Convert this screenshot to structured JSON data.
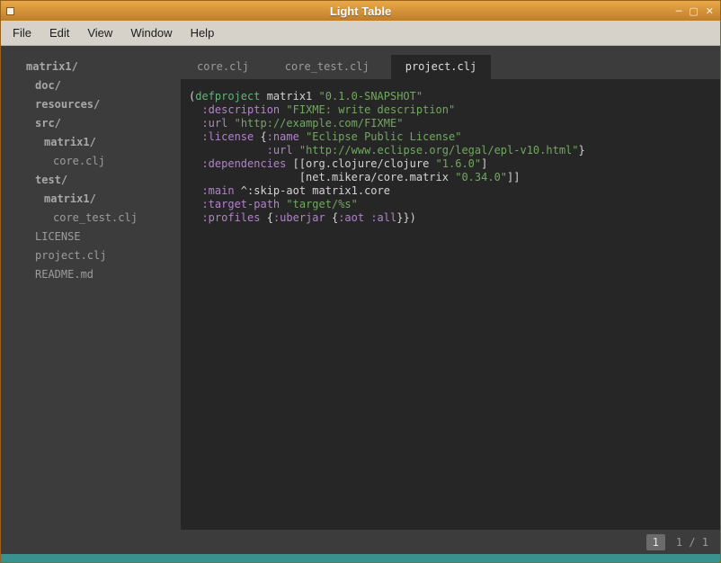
{
  "window": {
    "title": "Light Table",
    "controls": {
      "minimize": "─",
      "maximize": "▢",
      "close": "✕"
    }
  },
  "menubar": {
    "items": [
      "File",
      "Edit",
      "View",
      "Window",
      "Help"
    ]
  },
  "sidebar": {
    "items": [
      {
        "label": "matrix1/",
        "indent": 0,
        "folder": true
      },
      {
        "label": "doc/",
        "indent": 1,
        "folder": true
      },
      {
        "label": "resources/",
        "indent": 1,
        "folder": true
      },
      {
        "label": "src/",
        "indent": 1,
        "folder": true
      },
      {
        "label": "matrix1/",
        "indent": 2,
        "folder": true
      },
      {
        "label": "core.clj",
        "indent": 3,
        "folder": false
      },
      {
        "label": "test/",
        "indent": 1,
        "folder": true
      },
      {
        "label": "matrix1/",
        "indent": 2,
        "folder": true
      },
      {
        "label": "core_test.clj",
        "indent": 3,
        "folder": false
      },
      {
        "label": "LICENSE",
        "indent": 1,
        "folder": false
      },
      {
        "label": "project.clj",
        "indent": 1,
        "folder": false
      },
      {
        "label": "README.md",
        "indent": 1,
        "folder": false
      }
    ]
  },
  "tabs": [
    {
      "label": "core.clj",
      "active": false
    },
    {
      "label": "core_test.clj",
      "active": false
    },
    {
      "label": "project.clj",
      "active": true
    }
  ],
  "editor": {
    "lines": [
      [
        {
          "c": "pl",
          "t": "("
        },
        {
          "c": "df",
          "t": "defproject"
        },
        {
          "c": "pl",
          "t": " matrix1 "
        },
        {
          "c": "st",
          "t": "\"0.1.0-SNAPSHOT\""
        }
      ],
      [
        {
          "c": "pl",
          "t": "  "
        },
        {
          "c": "kw",
          "t": ":description"
        },
        {
          "c": "pl",
          "t": " "
        },
        {
          "c": "st",
          "t": "\"FIXME: write description\""
        }
      ],
      [
        {
          "c": "pl",
          "t": "  "
        },
        {
          "c": "kw",
          "t": ":url"
        },
        {
          "c": "pl",
          "t": " "
        },
        {
          "c": "st",
          "t": "\"http://example.com/FIXME\""
        }
      ],
      [
        {
          "c": "pl",
          "t": "  "
        },
        {
          "c": "kw",
          "t": ":license"
        },
        {
          "c": "pl",
          "t": " {"
        },
        {
          "c": "kw",
          "t": ":name"
        },
        {
          "c": "pl",
          "t": " "
        },
        {
          "c": "st",
          "t": "\"Eclipse Public License\""
        }
      ],
      [
        {
          "c": "pl",
          "t": "            "
        },
        {
          "c": "kw",
          "t": ":url"
        },
        {
          "c": "pl",
          "t": " "
        },
        {
          "c": "st",
          "t": "\"http://www.eclipse.org/legal/epl-v10.html\""
        },
        {
          "c": "pl",
          "t": "}"
        }
      ],
      [
        {
          "c": "pl",
          "t": "  "
        },
        {
          "c": "kw",
          "t": ":dependencies"
        },
        {
          "c": "pl",
          "t": " [[org.clojure/clojure "
        },
        {
          "c": "st",
          "t": "\"1.6.0\""
        },
        {
          "c": "pl",
          "t": "]"
        }
      ],
      [
        {
          "c": "pl",
          "t": "                 [net.mikera/core.matrix "
        },
        {
          "c": "st",
          "t": "\"0.34.0\""
        },
        {
          "c": "pl",
          "t": "]]"
        }
      ],
      [
        {
          "c": "pl",
          "t": "  "
        },
        {
          "c": "kw",
          "t": ":main"
        },
        {
          "c": "pl",
          "t": " ^:skip-aot matrix1.core"
        }
      ],
      [
        {
          "c": "pl",
          "t": "  "
        },
        {
          "c": "kw",
          "t": ":target-path"
        },
        {
          "c": "pl",
          "t": " "
        },
        {
          "c": "st",
          "t": "\"target/%s\""
        }
      ],
      [
        {
          "c": "pl",
          "t": "  "
        },
        {
          "c": "kw",
          "t": ":profiles"
        },
        {
          "c": "pl",
          "t": " {"
        },
        {
          "c": "kw",
          "t": ":uberjar"
        },
        {
          "c": "pl",
          "t": " {"
        },
        {
          "c": "kw",
          "t": ":aot"
        },
        {
          "c": "pl",
          "t": " "
        },
        {
          "c": "kw",
          "t": ":all"
        },
        {
          "c": "pl",
          "t": "}})"
        }
      ]
    ]
  },
  "statusbar": {
    "current_page": "1",
    "page_count": "1 / 1"
  },
  "colors": {
    "titlebar_top": "#eaa948",
    "titlebar_bottom": "#bf7d29",
    "menubar_bg": "#d6d2c9",
    "panel_bg": "#3c3c3c",
    "editor_bg": "#262626",
    "keyword": "#b183c9",
    "string": "#71a85f",
    "def_form": "#68b07a",
    "plain_text": "#d4d4d4",
    "bottom_bar": "#3a928e"
  }
}
